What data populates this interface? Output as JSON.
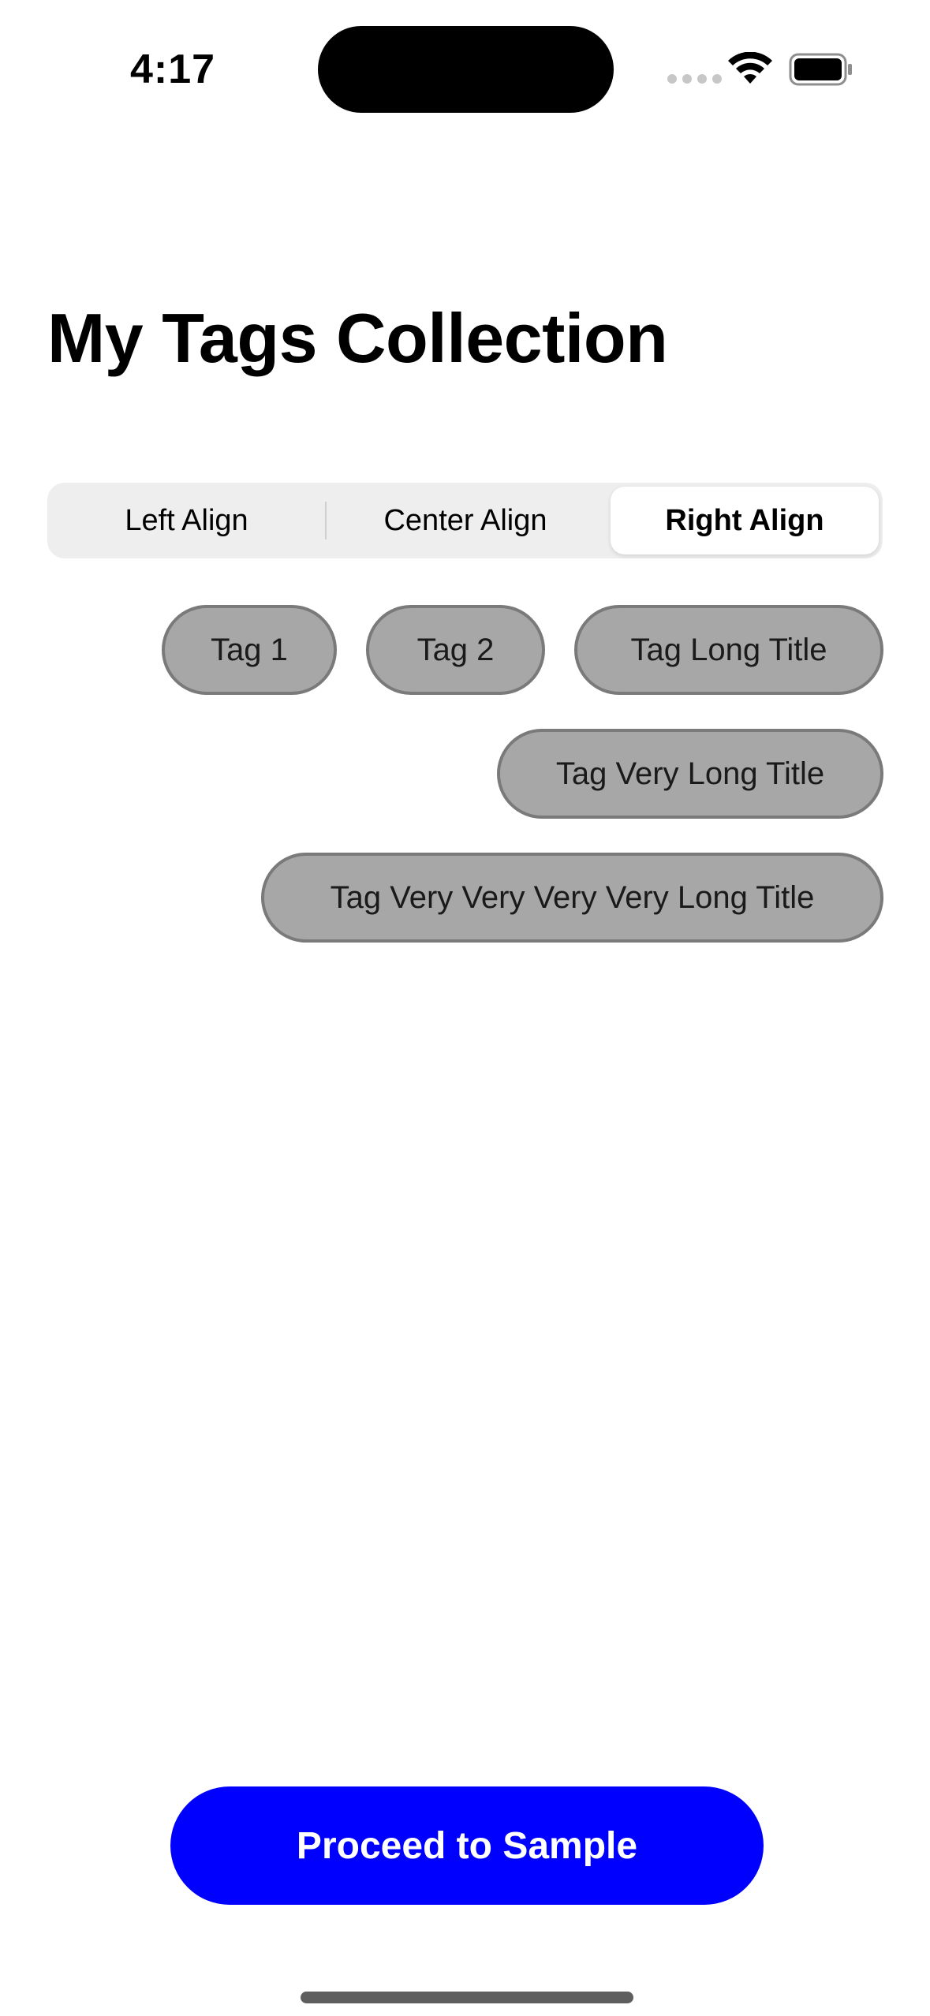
{
  "status_bar": {
    "time": "4:17",
    "icons": [
      "signal-dots-icon",
      "wifi-icon",
      "battery-icon"
    ]
  },
  "title": "My Tags Collection",
  "alignment_control": {
    "segments": [
      "Left Align",
      "Center Align",
      "Right Align"
    ],
    "selected": "Right Align"
  },
  "tags": [
    "Tag 1",
    "Tag 2",
    "Tag Long Title",
    "Tag Very Long Title",
    "Tag Very Very Very Very Long Title"
  ],
  "proceed_button": {
    "label": "Proceed to Sample"
  },
  "colors": {
    "accent": "#0000ff",
    "tag_fill": "#a7a7a7",
    "tag_border": "#7a7a7a",
    "segment_background": "#eeeeef"
  }
}
